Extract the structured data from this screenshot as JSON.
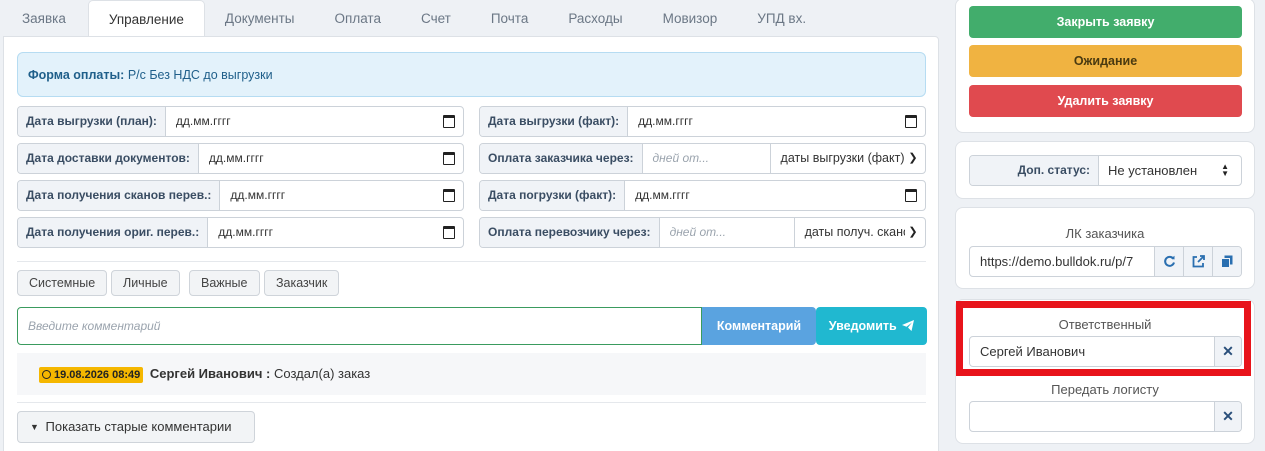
{
  "tabs": [
    "Заявка",
    "Управление",
    "Документы",
    "Оплата",
    "Счет",
    "Почта",
    "Расходы",
    "Мовизор",
    "УПД вх."
  ],
  "active_tab_index": 1,
  "payment": {
    "label": "Форма оплаты:",
    "value": "Р/с Без НДС до выгрузки"
  },
  "fields": {
    "unload_plan": {
      "label": "Дата выгрузки (план):",
      "value": "дд.мм.гггг"
    },
    "docs_delivery": {
      "label": "Дата доставки документов:",
      "value": "дд.мм.гггг"
    },
    "scans_received": {
      "label": "Дата получения сканов перев.:",
      "value": "дд.мм.гггг"
    },
    "originals_received": {
      "label": "Дата получения ориг. перев.:",
      "value": "дд.мм.гггг"
    },
    "unload_fact": {
      "label": "Дата выгрузки (факт):",
      "value": "дд.мм.гггг"
    },
    "customer_payment": {
      "label": "Оплата заказчика через:",
      "placeholder": "дней от...",
      "select": "даты выгрузки (факт)"
    },
    "load_fact": {
      "label": "Дата погрузки (факт):",
      "value": "дд.мм.гггг"
    },
    "carrier_payment": {
      "label": "Оплата перевозчику через:",
      "placeholder": "дней от...",
      "select": "даты получ. сканов"
    }
  },
  "filters": [
    "Системные",
    "Личные",
    "Важные",
    "Заказчик"
  ],
  "comment": {
    "placeholder": "Введите комментарий",
    "submit_label": "Комментарий",
    "notify_label": "Уведомить"
  },
  "log": [
    {
      "time": "19.08.2026 08:49",
      "author": "Сергей Иванович :",
      "text": "Создал(а) заказ"
    }
  ],
  "old_comments_label": "Показать старые комментарии",
  "actions": {
    "close": "Закрыть заявку",
    "wait": "Ожидание",
    "delete": "Удалить заявку"
  },
  "extra_status": {
    "label": "Доп. статус:",
    "value": "Не установлен"
  },
  "customer_portal": {
    "title": "ЛК заказчика",
    "url": "https://demo.bulldok.ru/p/7"
  },
  "responsible": {
    "title": "Ответственный",
    "value": "Сергей Иванович"
  },
  "transfer": {
    "title": "Передать логисту",
    "value": ""
  },
  "colors": {
    "close": "#42ad6c",
    "wait": "#f0b341",
    "delete": "#e04a4f",
    "highlight": "#e8141b",
    "notify": "#20b8d0",
    "comment": "#5aa3e0"
  }
}
